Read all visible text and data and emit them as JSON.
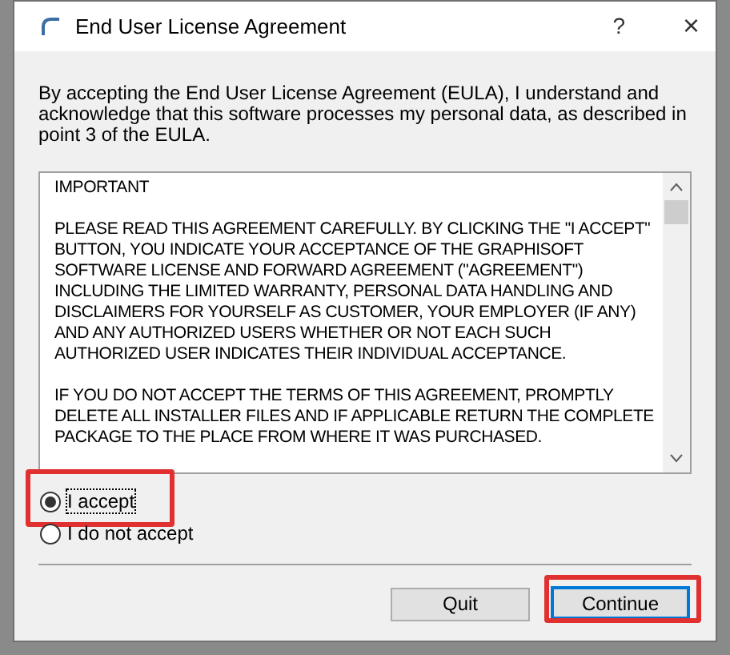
{
  "window": {
    "title": "End User License Agreement",
    "buttons": [
      "?",
      "×"
    ]
  },
  "intro": "By accepting the End User License Agreement (EULA), I understand and acknowledge that this software processes my personal data, as described in point 3 of the EULA.",
  "license_text": [
    "IMPORTANT",
    "PLEASE READ THIS AGREEMENT CAREFULLY. BY CLICKING THE \"I ACCEPT\" BUTTON, YOU INDICATE YOUR ACCEPTANCE OF THE GRAPHISOFT SOFTWARE LICENSE AND FORWARD AGREEMENT (\"AGREEMENT\") INCLUDING THE LIMITED WARRANTY, PERSONAL DATA HANDLING AND DISCLAIMERS FOR YOURSELF AS CUSTOMER, YOUR EMPLOYER (IF ANY) AND ANY AUTHORIZED USERS WHETHER OR NOT EACH SUCH AUTHORIZED USER INDICATES THEIR INDIVIDUAL ACCEPTANCE.",
    "IF YOU DO NOT ACCEPT THE TERMS OF THIS AGREEMENT, PROMPTLY DELETE ALL INSTALLER FILES AND IF APPLICABLE RETURN THE COMPLETE PACKAGE TO THE PLACE FROM WHERE IT WAS PURCHASED."
  ],
  "options": [
    {
      "label": "I accept",
      "selected": true,
      "highlighted": true
    },
    {
      "label": "I do not accept",
      "selected": false,
      "highlighted": false
    }
  ],
  "buttons": [
    {
      "label": "Quit",
      "default": false,
      "highlighted": false
    },
    {
      "label": "Continue",
      "default": true,
      "highlighted": true
    }
  ]
}
